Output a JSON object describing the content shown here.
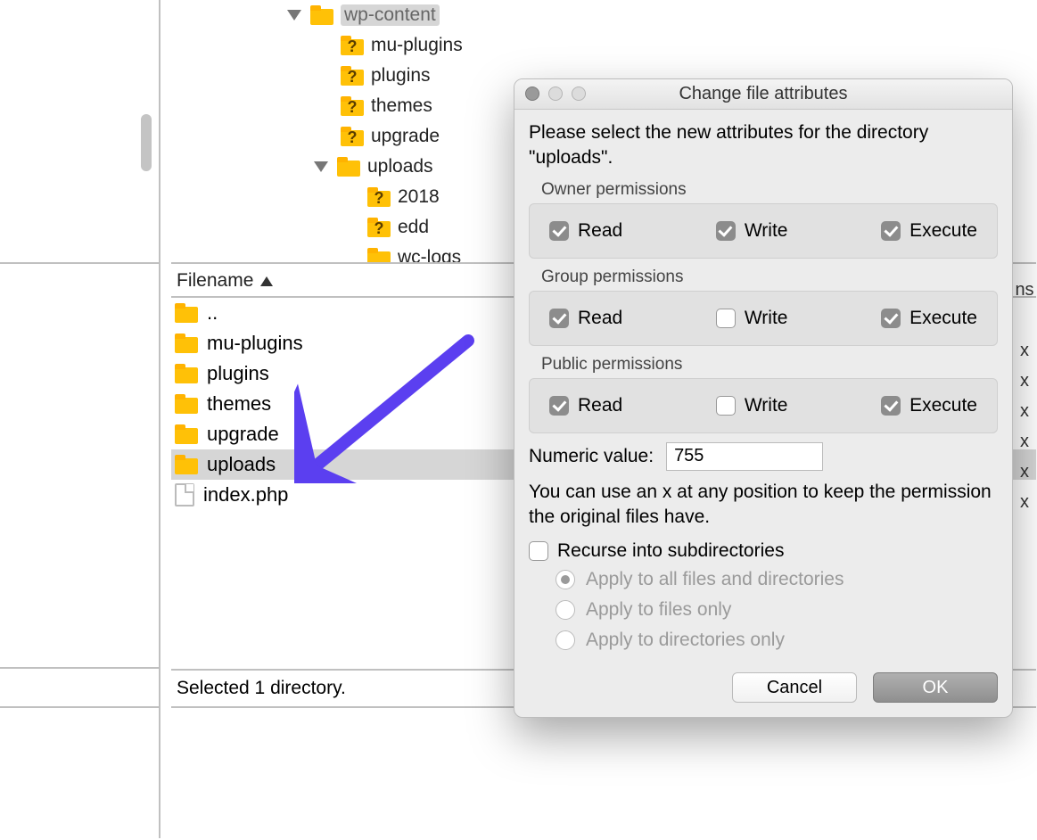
{
  "tree": {
    "root": "wp-content",
    "items": [
      {
        "label": "mu-plugins",
        "status": "q"
      },
      {
        "label": "plugins",
        "status": "q"
      },
      {
        "label": "themes",
        "status": "q"
      },
      {
        "label": "upgrade",
        "status": "q"
      },
      {
        "label": "uploads",
        "status": "folder",
        "expanded": true
      }
    ],
    "uploads_children": [
      {
        "label": "2018",
        "status": "q"
      },
      {
        "label": "edd",
        "status": "q"
      },
      {
        "label": "wc-logs",
        "status": "folder"
      }
    ]
  },
  "file_list": {
    "header": "Filename",
    "rows": [
      {
        "name": "..",
        "type": "folder",
        "selected": false
      },
      {
        "name": "mu-plugins",
        "type": "folder",
        "selected": false
      },
      {
        "name": "plugins",
        "type": "folder",
        "selected": false
      },
      {
        "name": "themes",
        "type": "folder",
        "selected": false
      },
      {
        "name": "upgrade",
        "type": "folder",
        "selected": false
      },
      {
        "name": "uploads",
        "type": "folder",
        "selected": true
      },
      {
        "name": "index.php",
        "type": "file",
        "selected": false
      }
    ],
    "right_col": [
      "ns",
      "",
      "x",
      "x",
      "x",
      "x",
      "x",
      "x"
    ]
  },
  "status_bar": "Selected 1 directory.",
  "dialog": {
    "title": "Change file attributes",
    "instruction": "Please select the new attributes for the directory \"uploads\".",
    "groups": {
      "owner": {
        "label": "Owner permissions",
        "read": true,
        "write": true,
        "execute": true
      },
      "group": {
        "label": "Group permissions",
        "read": true,
        "write": false,
        "execute": true
      },
      "public": {
        "label": "Public permissions",
        "read": true,
        "write": false,
        "execute": true
      }
    },
    "perm_labels": {
      "read": "Read",
      "write": "Write",
      "execute": "Execute"
    },
    "numeric_label": "Numeric value:",
    "numeric_value": "755",
    "help": "You can use an x at any position to keep the permission the original files have.",
    "recurse_label": "Recurse into subdirectories",
    "recurse_checked": false,
    "radios": [
      {
        "label": "Apply to all files and directories",
        "selected": true
      },
      {
        "label": "Apply to files only",
        "selected": false
      },
      {
        "label": "Apply to directories only",
        "selected": false
      }
    ],
    "buttons": {
      "cancel": "Cancel",
      "ok": "OK"
    }
  }
}
